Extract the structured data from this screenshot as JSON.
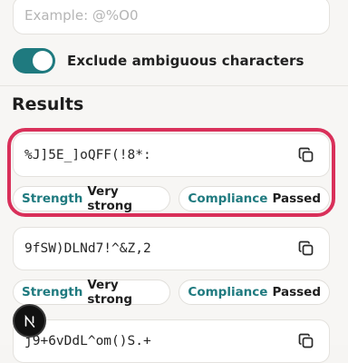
{
  "example_input": {
    "placeholder": "Example: @%O0"
  },
  "exclude_toggle": {
    "label": "Exclude ambiguous characters",
    "checked": true
  },
  "results": {
    "heading": "Results",
    "items": [
      {
        "password": "%J]5E_]oQFF(!8*:",
        "strength_label": "Strength",
        "strength_value": "Very strong",
        "compliance_label": "Compliance",
        "compliance_value": "Passed"
      },
      {
        "password": "9fSW)DLNd7!^&Z,2",
        "strength_label": "Strength",
        "strength_value": "Very strong",
        "compliance_label": "Compliance",
        "compliance_value": "Passed"
      },
      {
        "password": "j9+6vDdL^om()S.+",
        "strength_label": "",
        "strength_value": "",
        "compliance_label": "",
        "compliance_value": ""
      }
    ]
  },
  "colors": {
    "accent": "#1f7a7f",
    "highlight": "#d9305a"
  },
  "icons": {
    "copy": "copy-icon",
    "fab": "next-logo-icon"
  }
}
